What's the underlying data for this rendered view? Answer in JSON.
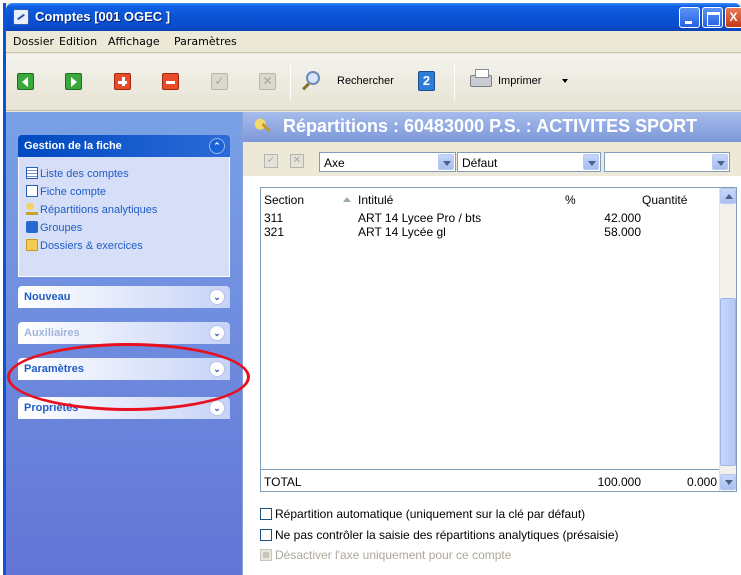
{
  "window": {
    "title": "Comptes [001 OGEC ]",
    "controls": {
      "minimize": "",
      "maximize": "",
      "close": "X"
    }
  },
  "menu": [
    "Dossier",
    "Edition",
    "Affichage",
    "Paramètres"
  ],
  "toolbar": {
    "search_label": "Rechercher",
    "refresh_glyph": "2",
    "print_label": "Imprimer",
    "check_glyph": "✓",
    "cross_glyph": "✕"
  },
  "taskpane": {
    "gestion": {
      "title": "Gestion de la fiche",
      "items": [
        {
          "label": "Liste des comptes",
          "icon": "list-icon"
        },
        {
          "label": "Fiche compte",
          "icon": "card-icon"
        },
        {
          "label": "Répartitions analytiques",
          "icon": "key-icon"
        },
        {
          "label": "Groupes",
          "icon": "group-icon"
        },
        {
          "label": "Dossiers & exercices",
          "icon": "folder-icon"
        }
      ]
    },
    "groups": [
      {
        "label": "Nouveau",
        "enabled": true
      },
      {
        "label": "Auxiliaires",
        "enabled": false
      },
      {
        "label": "Paramètres",
        "enabled": true
      },
      {
        "label": "Propriétés",
        "enabled": true
      }
    ],
    "chevron_up": "⌃",
    "chevron_down": "⌄"
  },
  "content": {
    "title": "Répartitions : 60483000 P.S. : ACTIVITES SPORT",
    "filters": {
      "check_glyph": "✓",
      "cross_glyph": "✕",
      "axe": "Axe",
      "cle": "Défaut",
      "third": ""
    },
    "table": {
      "headers": {
        "section": "Section",
        "intitule": "Intitulé",
        "pct": "%",
        "qty": "Quantité"
      },
      "rows": [
        {
          "section": "311",
          "intitule": "ART 14 Lycee Pro / bts",
          "pct": "42.000",
          "qty": ""
        },
        {
          "section": "321",
          "intitule": "ART 14 Lycée gl",
          "pct": "58.000",
          "qty": ""
        }
      ],
      "total": {
        "label": "TOTAL",
        "pct": "100.000",
        "qty": "0.000"
      }
    },
    "options": [
      {
        "label": "Répartition automatique (uniquement sur la clé par défaut)",
        "checked": false,
        "enabled": true
      },
      {
        "label": "Ne pas contrôler la saisie des répartitions analytiques (présaisie)",
        "checked": false,
        "enabled": true
      },
      {
        "label": "Désactiver l'axe uniquement pour ce compte",
        "checked": false,
        "enabled": false
      }
    ]
  },
  "annotation": {
    "color": "#e8101e"
  }
}
